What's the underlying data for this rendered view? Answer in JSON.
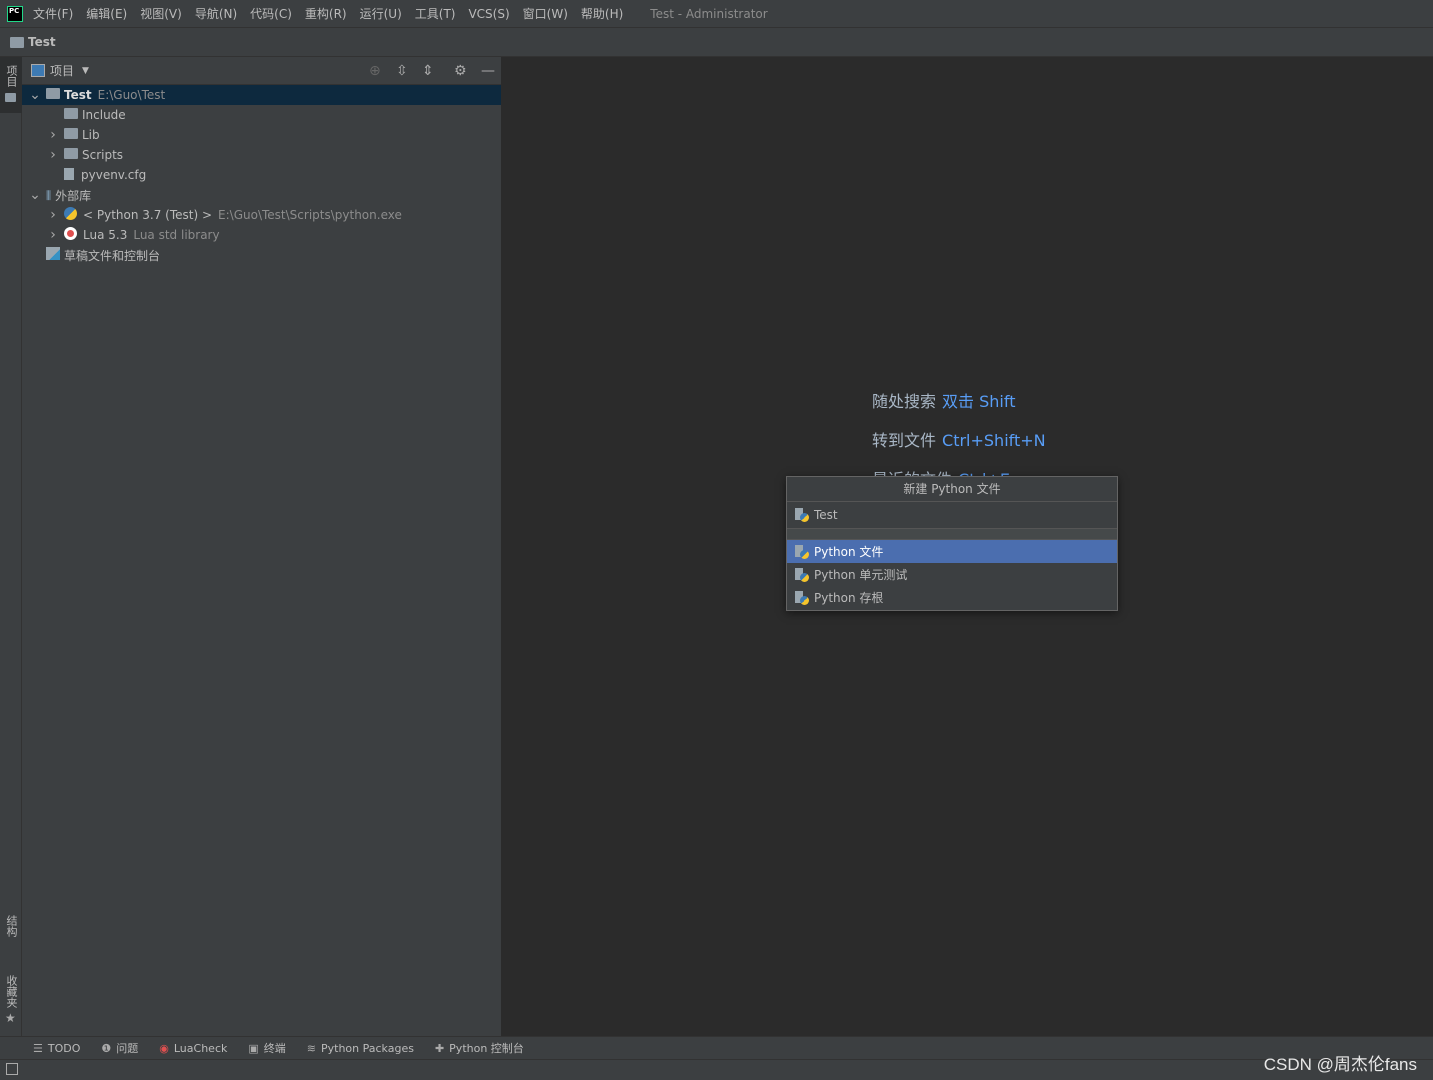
{
  "app": {
    "logo": "PC",
    "title": "Test - Administrator"
  },
  "menu": [
    "文件(F)",
    "编辑(E)",
    "视图(V)",
    "导航(N)",
    "代码(C)",
    "重构(R)",
    "运行(U)",
    "工具(T)",
    "VCS(S)",
    "窗口(W)",
    "帮助(H)"
  ],
  "breadcrumb": "Test",
  "left_strip": {
    "top": "项目",
    "structure": "结构",
    "favorites": "收藏夹"
  },
  "panel": {
    "title": "项目"
  },
  "tree": [
    {
      "name": "Test",
      "extra": "E:\\Guo\\Test",
      "level": 0,
      "arrow": "down",
      "icon": "folder-icon",
      "selected": true
    },
    {
      "name": "Include",
      "level": 1,
      "arrow": "",
      "icon": "folder-icon"
    },
    {
      "name": "Lib",
      "level": 1,
      "arrow": "right",
      "icon": "folder-icon"
    },
    {
      "name": "Scripts",
      "level": 1,
      "arrow": "right",
      "icon": "folder-icon"
    },
    {
      "name": "pyvenv.cfg",
      "level": 1,
      "arrow": "",
      "icon": "file-icon"
    },
    {
      "name": "外部库",
      "level": 0,
      "arrow": "down",
      "icon": "library-icon"
    },
    {
      "name": "< Python 3.7 (Test) >",
      "extra": "E:\\Guo\\Test\\Scripts\\python.exe",
      "level": 1,
      "arrow": "right",
      "icon": "python-icon"
    },
    {
      "name": "Lua 5.3",
      "extra": "Lua std library",
      "level": 1,
      "arrow": "right",
      "icon": "lua-icon"
    },
    {
      "name": "草稿文件和控制台",
      "level": 0,
      "arrow": "none",
      "icon": "scratch-icon"
    }
  ],
  "hints": [
    {
      "label": "随处搜索",
      "key": "双击 Shift"
    },
    {
      "label": "转到文件",
      "key": "Ctrl+Shift+N"
    },
    {
      "label": "最近的文件",
      "key": "Ctrl+E"
    }
  ],
  "popup": {
    "title": "新建 Python 文件",
    "input": "Test",
    "items": [
      "Python 文件",
      "Python 单元测试",
      "Python 存根"
    ],
    "selected_index": 0
  },
  "bottom_tools": [
    "TODO",
    "问题",
    "LuaCheck",
    "终端",
    "Python Packages",
    "Python 控制台"
  ],
  "watermark": "CSDN @周杰伦fans",
  "colors": {
    "accent": "#589df6",
    "selection": "#4b6eaf",
    "tree_selection": "#0d293e"
  }
}
